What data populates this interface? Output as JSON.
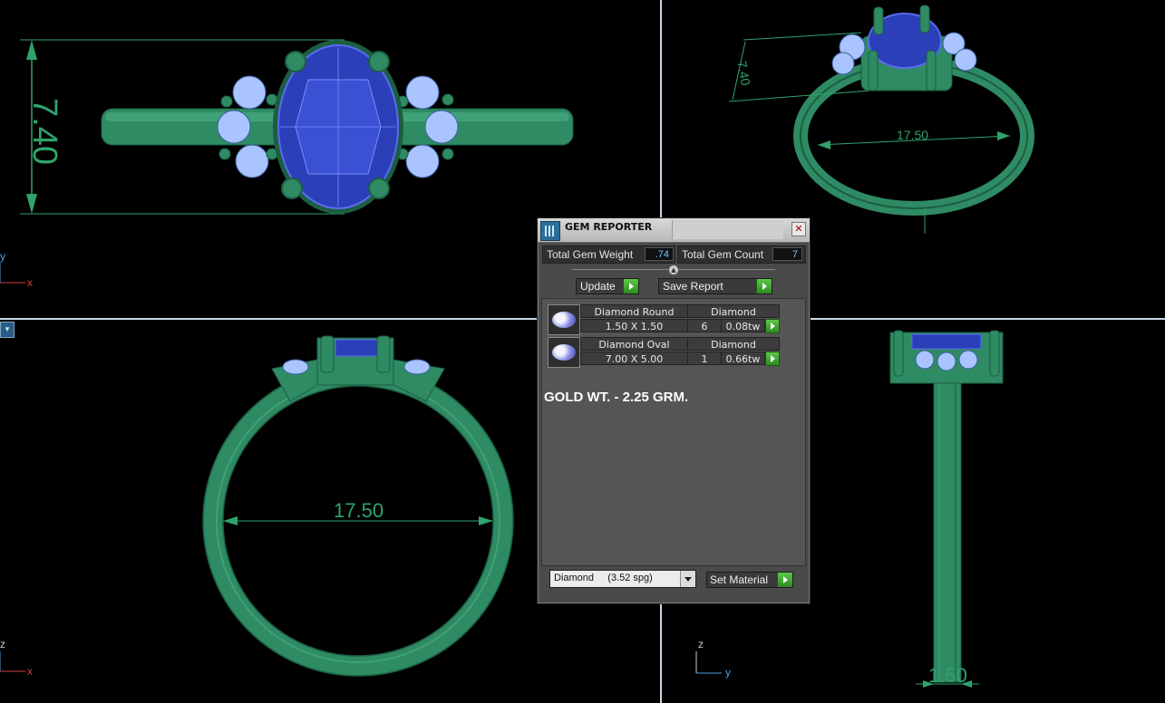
{
  "colors": {
    "background": "#000000",
    "ring_green": "#2e8b64",
    "ring_dark": "#1c5e42",
    "gem_blue": "#2b3fb8",
    "diamond_light": "#a9c4ff",
    "dimension_green": "#2fa36b",
    "axis_red": "#d23c3c",
    "axis_blue": "#4aa0e0",
    "value_cyan": "#6fc8ff"
  },
  "viewports": {
    "top_left": {
      "dimension": "7.40",
      "axis_y": "y",
      "axis_x": "x"
    },
    "top_right": {
      "dimension_height": "7.40",
      "dimension_width": "17.50"
    },
    "bottom_left": {
      "dimension": "17.50",
      "axis_z": "z",
      "axis_x": "x"
    },
    "bottom_right": {
      "dimension": "1.50",
      "axis_z": "z",
      "axis_y": "y"
    }
  },
  "gem_reporter": {
    "title": "GEM REPORTER",
    "close_icon": "close-icon",
    "total_weight_label": "Total Gem Weight",
    "total_weight_value": ".74",
    "total_count_label": "Total Gem Count",
    "total_count_value": "7",
    "update_label": "Update",
    "save_report_label": "Save Report",
    "gems": [
      {
        "shape": "Diamond Round",
        "material": "Diamond",
        "size": "1.50 X 1.50",
        "count": "6",
        "weight": "0.08tw"
      },
      {
        "shape": "Diamond Oval",
        "material": "Diamond",
        "size": "7.00 X 5.00",
        "count": "1",
        "weight": "0.66tw"
      }
    ],
    "note": "GOLD WT. - 2.25 GRM.",
    "material_select": "Diamond     (3.52 spg)",
    "set_material_label": "Set Material"
  }
}
